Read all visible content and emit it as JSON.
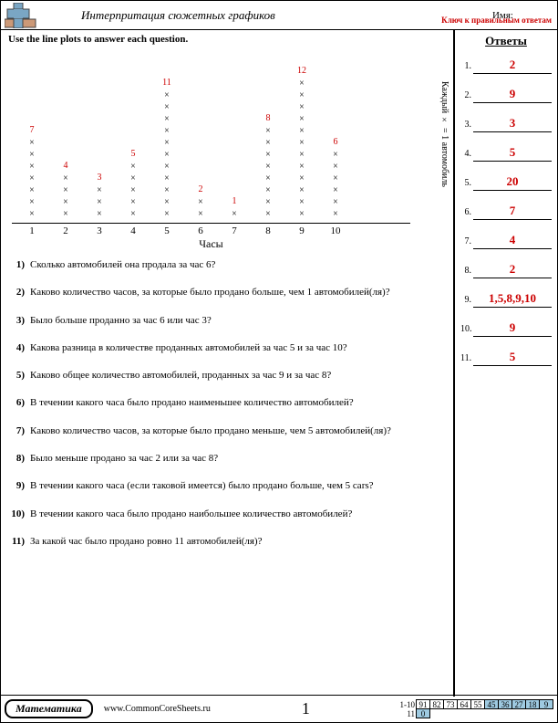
{
  "header": {
    "title": "Интерпритация сюжетных графиков",
    "name_label": "Имя:",
    "key_label": "Ключ к правильным ответам"
  },
  "instruction": "Use the line plots to answer each question.",
  "chart_data": {
    "type": "bar",
    "categories": [
      "1",
      "2",
      "3",
      "4",
      "5",
      "6",
      "7",
      "8",
      "9",
      "10"
    ],
    "values": [
      7,
      4,
      3,
      5,
      11,
      2,
      1,
      8,
      12,
      6
    ],
    "xlabel": "Часы",
    "legend": "Каждый × = 1 автомобиль"
  },
  "questions": [
    {
      "num": "1)",
      "text": "Сколько автомобилей она продала за час 6?"
    },
    {
      "num": "2)",
      "text": "Каково количество часов, за которые было продано больше, чем 1 автомобилей(ля)?"
    },
    {
      "num": "3)",
      "text": "Было больше проданно за час 6 или час 3?"
    },
    {
      "num": "4)",
      "text": "Какова разница в количестве проданных автомобилей за час 5 и за час 10?"
    },
    {
      "num": "5)",
      "text": "Каково общее количество автомобилей, проданных за час 9 и за час 8?"
    },
    {
      "num": "6)",
      "text": "В течении какого часа было продано наименьшее количество автомобилей?"
    },
    {
      "num": "7)",
      "text": "Каково количество часов, за которые было продано меньше, чем 5 автомобилей(ля)?"
    },
    {
      "num": "8)",
      "text": "Было меньше продано за час 2 или за час 8?"
    },
    {
      "num": "9)",
      "text": "В течении какого часа (если таковой имеется) было продано больше, чем 5 cars?"
    },
    {
      "num": "10)",
      "text": "В течении какого часа было продано наибольшее количество автомобилей?"
    },
    {
      "num": "11)",
      "text": "За какой час было продано ровно 11 автомобилей(ля)?"
    }
  ],
  "sidebar": {
    "title": "Ответы",
    "answers": [
      {
        "num": "1.",
        "val": "2"
      },
      {
        "num": "2.",
        "val": "9"
      },
      {
        "num": "3.",
        "val": "3"
      },
      {
        "num": "4.",
        "val": "5"
      },
      {
        "num": "5.",
        "val": "20"
      },
      {
        "num": "6.",
        "val": "7"
      },
      {
        "num": "7.",
        "val": "4"
      },
      {
        "num": "8.",
        "val": "2"
      },
      {
        "num": "9.",
        "val": "1,5,8,9,10"
      },
      {
        "num": "10.",
        "val": "9"
      },
      {
        "num": "11.",
        "val": "5"
      }
    ]
  },
  "footer": {
    "subject": "Математика",
    "site": "www.CommonCoreSheets.ru",
    "page": "1",
    "score_rows": [
      {
        "label": "1-10",
        "cells": [
          "91",
          "82",
          "73",
          "64",
          "55",
          "45",
          "36",
          "27",
          "18",
          "9"
        ]
      },
      {
        "label": "11",
        "cells": [
          "0",
          "",
          "",
          "",
          "",
          "",
          "",
          "",
          "",
          ""
        ]
      }
    ]
  }
}
